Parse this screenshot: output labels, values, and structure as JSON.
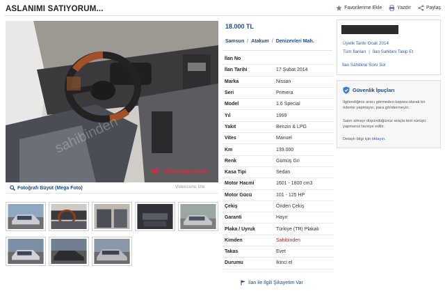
{
  "header": {
    "title": "ASLANIMI SATIYORUM...",
    "actions": [
      {
        "label": "Favorilerime Ekle",
        "icon": "star-icon"
      },
      {
        "label": "Yazdır",
        "icon": "print-icon"
      },
      {
        "label": "Paylaş",
        "icon": "share-icon"
      }
    ]
  },
  "price": "18.000 TL",
  "location": {
    "city": "Samsun",
    "sep1": "/",
    "district": "Atakum",
    "sep2": "/",
    "neighborhood": "Denizevleri Mah."
  },
  "gallery": {
    "mega_photo": "Fotoğrafı Büyüt (Mega Foto)",
    "watermark": "@pasagoynum",
    "video_link": "Videosunu İzle"
  },
  "details": [
    {
      "key": "İlan No",
      "value": ""
    },
    {
      "key": "İlan Tarihi",
      "value": "17 Şubat 2014"
    },
    {
      "key": "Marka",
      "value": "Nissan"
    },
    {
      "key": "Seri",
      "value": "Primera"
    },
    {
      "key": "Model",
      "value": "1.6 Special"
    },
    {
      "key": "Yıl",
      "value": "1999"
    },
    {
      "key": "Yakıt",
      "value": "Benzin & LPG"
    },
    {
      "key": "Vites",
      "value": "Manuel"
    },
    {
      "key": "Km",
      "value": "139.000"
    },
    {
      "key": "Renk",
      "value": "Gümüş Gri"
    },
    {
      "key": "Kasa Tipi",
      "value": "Sedan"
    },
    {
      "key": "Motor Hacmi",
      "value": "1601 - 1800 cm3"
    },
    {
      "key": "Motor Gücü",
      "value": "101 - 125 HP"
    },
    {
      "key": "Çekiş",
      "value": "Önden Çekiş"
    },
    {
      "key": "Garanti",
      "value": "Hayır"
    },
    {
      "key": "Plaka / Uyruk",
      "value": "Türkiye (TR) Plakalı"
    },
    {
      "key": "Kimden",
      "value": "Sahibinden"
    },
    {
      "key": "Takas",
      "value": "Evet"
    },
    {
      "key": "Durumu",
      "value": "İkinci el"
    }
  ],
  "complaint": "İlan ile İlgili Şikayetim Var",
  "seller": {
    "member_since": "Üyelik Tarihi  Ocak 2014",
    "all_ads": "Tüm İlanları",
    "sep": "|",
    "follow": "İlan Sahibini Takip Et",
    "ask": "İlan Sahibine Soru Sor"
  },
  "safety": {
    "title": "Güvenlik İpuçları",
    "p1": "İlgilendiğiniz aracı görmeden kapora olarak bir ödeme yapmayın, para göndermeyin.",
    "p2": "Satın almayı düşündüğünüz araçla test sürüşü yapmanız tavsiye edilir.",
    "p3_text": "Detaylı bilgi için ",
    "p3_link": "tıklayın."
  },
  "colors": {
    "link": "#1d4c86",
    "red": "#b5202f",
    "watermark": "#d42c3f"
  }
}
